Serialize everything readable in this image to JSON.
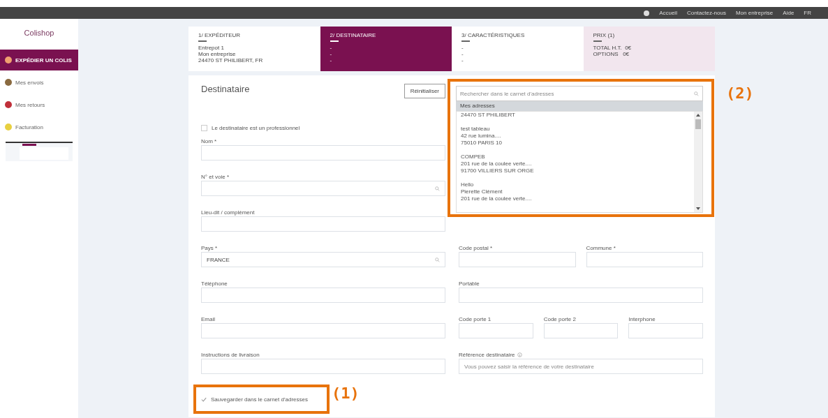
{
  "top_bar": {
    "links": [
      "Accueil",
      "Contactez-nous",
      "Mon entreprise",
      "Aide",
      "FR"
    ]
  },
  "sidebar": {
    "logo": "Colishop",
    "items": [
      {
        "label": "EXPÉDIER UN COLIS",
        "selected": true,
        "color": "#f0a070"
      },
      {
        "label": "Mes envois",
        "selected": false,
        "color": "#8a6a40"
      },
      {
        "label": "Mes retours",
        "selected": false,
        "color": "#c0303a"
      },
      {
        "label": "Facturation",
        "selected": false,
        "color": "#e8d040"
      }
    ]
  },
  "steps": [
    {
      "title": "1/ EXPÉDITEUR",
      "lines": [
        "Entrepot 1",
        "Mon entreprise",
        "24470 ST PHILIBERT, FR"
      ],
      "selected": false,
      "kind": "step"
    },
    {
      "title": "2/ DESTINATAIRE",
      "lines": [
        "-",
        "-",
        "-"
      ],
      "selected": true,
      "kind": "step"
    },
    {
      "title": "3/ CARACTÉRISTIQUES",
      "lines": [
        "-",
        "-",
        "-"
      ],
      "selected": false,
      "kind": "step"
    },
    {
      "title": "PRIX (1)",
      "lines": [
        "TOTAL H.T.  0€",
        "OPTIONS   0€"
      ],
      "selected": false,
      "kind": "price"
    }
  ],
  "form": {
    "title": "Destinataire",
    "reset_button": "Réinitialiser",
    "pro_checkbox": {
      "label": "Le destinataire est un professionnel",
      "checked": false
    },
    "top_fields": [
      {
        "label": "Nom *",
        "kind": "text"
      },
      {
        "label": "N° et voie *",
        "kind": "search"
      },
      {
        "label": "Lieu-dit / complément",
        "kind": "text"
      }
    ],
    "rows": [
      {
        "left": {
          "label": "Pays *",
          "value": "FRANCE",
          "kind": "search"
        },
        "right": [
          {
            "label": "Code postal *",
            "kind": "text"
          },
          {
            "label": "Commune *",
            "kind": "text"
          }
        ]
      },
      {
        "left": {
          "label": "Téléphone",
          "kind": "text"
        },
        "right": [
          {
            "label": "Portable",
            "kind": "text"
          }
        ]
      },
      {
        "left": {
          "label": "Email",
          "kind": "text"
        },
        "right": [
          {
            "label": "Code porte 1",
            "kind": "text"
          },
          {
            "label": "Code porte 2",
            "kind": "text"
          },
          {
            "label": "Interphone",
            "kind": "text"
          }
        ]
      },
      {
        "left": {
          "label": "Instructions de livraison",
          "kind": "text"
        },
        "right": [
          {
            "label": "Référence destinataire",
            "kind": "info",
            "placeholder": "Vous pouvez saisir la référence de votre destinataire"
          }
        ]
      }
    ],
    "save_checkbox": {
      "label": "Sauvegarder dans le carnet d'adresses",
      "checked": true
    }
  },
  "address_dropdown": {
    "placeholder": "Rechercher dans le carnet d'adresses",
    "group": "Mes adresses",
    "entries": [
      [
        "24470 ST PHILIBERT"
      ],
      [
        "test tableau",
        "42 rue lumina....",
        "75010 PARIS 10"
      ],
      [
        "COMPEB",
        "201 rue de la coulee verte....",
        "91700 VILLIERS SUR ORGE"
      ],
      [
        "Hello",
        "Pierette Clément",
        "201 rue de la coulee verte...."
      ]
    ]
  },
  "annotations": [
    "(1)",
    "(2)"
  ]
}
